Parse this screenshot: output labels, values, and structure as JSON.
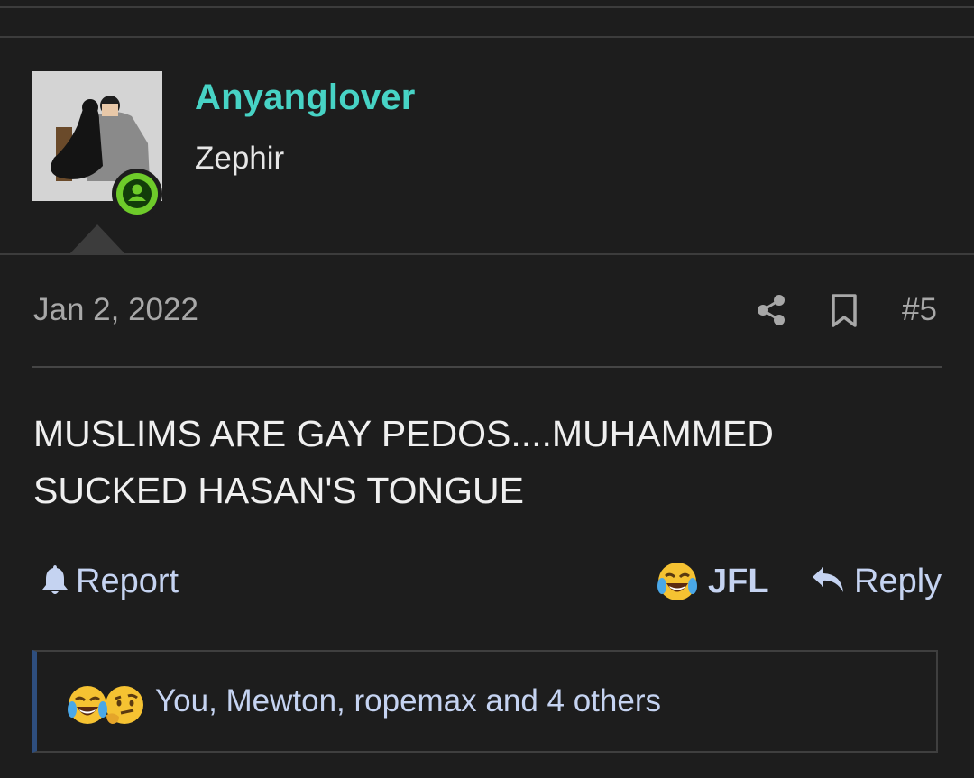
{
  "post": {
    "author": "Anyanglover",
    "author_title": "Zephir",
    "date": "Jan 2, 2022",
    "number": "#5",
    "body": "MUSLIMS ARE GAY PEDOS....MUHAMMED SUCKED HASAN'S TONGUE"
  },
  "actions": {
    "report": "Report",
    "react": "JFL",
    "reply": "Reply",
    "share_icon": "share-icon",
    "bookmark_icon": "bookmark-icon"
  },
  "reactions": {
    "summary": "You, Mewton, ropemax and 4 others",
    "emojis": [
      "laughing-crying-emoji",
      "thinking-emoji"
    ]
  },
  "colors": {
    "background": "#1d1d1d",
    "username": "#47d3c5",
    "link": "#c5d3f1",
    "online": "#6ecb2a"
  }
}
